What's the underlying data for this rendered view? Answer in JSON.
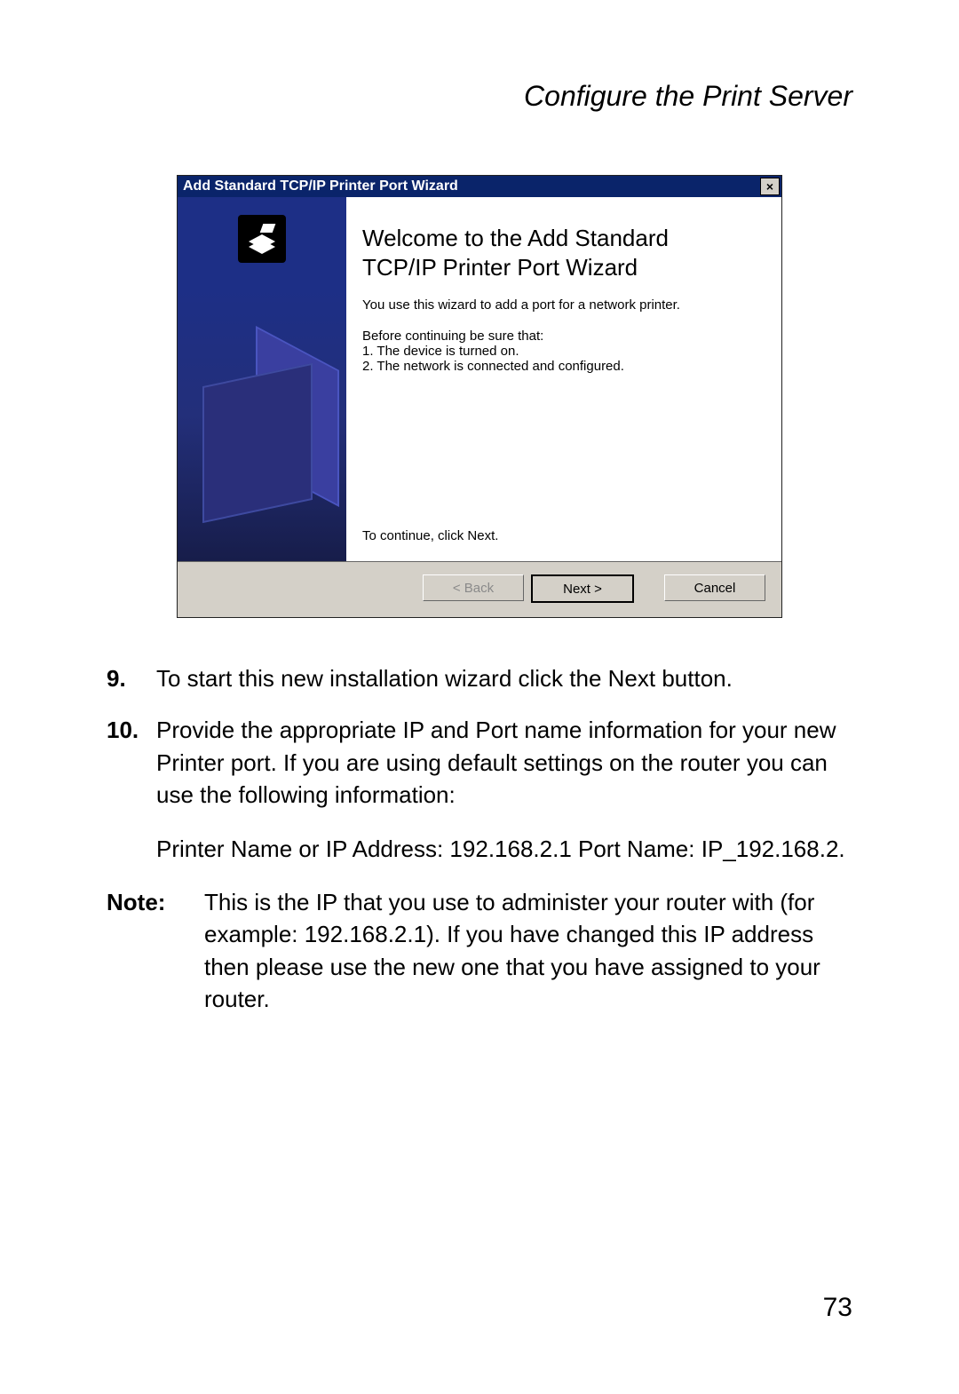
{
  "header": {
    "title": "Configure the Print Server"
  },
  "screenshot": {
    "titlebar": "Add Standard TCP/IP Printer Port Wizard",
    "close_glyph": "×",
    "heading_line1": "Welcome to the Add Standard",
    "heading_line2": "TCP/IP Printer Port Wizard",
    "intro": "You use this wizard to add a port for a network printer.",
    "before_label": "Before continuing be sure that:",
    "before_item1": "1.  The device is turned on.",
    "before_item2": "2.  The network is connected and configured.",
    "continue_text": "To continue, click Next.",
    "buttons": {
      "back": "< Back",
      "next": "Next >",
      "cancel": "Cancel"
    }
  },
  "steps": {
    "s9_num": "9.",
    "s9_text": "To start this new installation wizard click the Next button.",
    "s10_num": "10.",
    "s10_text": "Provide the appropriate IP and Port name information for your new Printer port. If you are using default settings on the router you can use the following information:",
    "s10_detail": "Printer Name or IP Address: 192.168.2.1 Port Name: IP_192.168.2."
  },
  "note": {
    "label": "Note:",
    "text": "This is the IP that you use to administer your router with (for example: 192.168.2.1). If you have changed this IP address then please use the new one that you have assigned to your router."
  },
  "page_number": "73"
}
